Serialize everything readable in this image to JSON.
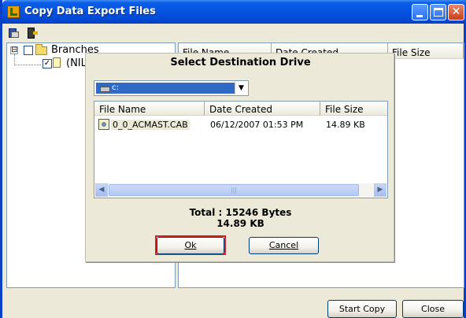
{
  "window": {
    "title": "Copy Data Export Files",
    "controls": {
      "minimize": "minimize-icon",
      "maximize": "maximize-icon",
      "close": "close-icon"
    }
  },
  "toolbar": {
    "icons": [
      "export-icon",
      "exit-icon"
    ]
  },
  "tree": {
    "expander": "⊟",
    "root_label": "Branches",
    "root_checked": false,
    "child_label": "(NIL",
    "child_checked": true
  },
  "file_list": {
    "columns": [
      "File Name",
      "Date Created",
      "File Size"
    ]
  },
  "buttons": {
    "start_copy": "Start Copy",
    "close": "Close"
  },
  "dialog": {
    "title": "Select Destination Drive",
    "drive": {
      "selected": "c:"
    },
    "list": {
      "columns": [
        "File Name",
        "Date Created",
        "File Size"
      ],
      "rows": [
        {
          "name": "0_0_ACMAST.CAB",
          "date": "06/12/2007 01:53 PM",
          "size": "14.89 KB"
        }
      ]
    },
    "total_line1": "Total : 15246 Bytes",
    "total_line2": "14.89 KB",
    "ok_label": "Ok",
    "cancel_label": "Cancel",
    "highlight_color": "#d8202a"
  },
  "colors": {
    "titlebar": "#0553e0",
    "selection": "#316ac5",
    "face": "#ece9d8"
  }
}
